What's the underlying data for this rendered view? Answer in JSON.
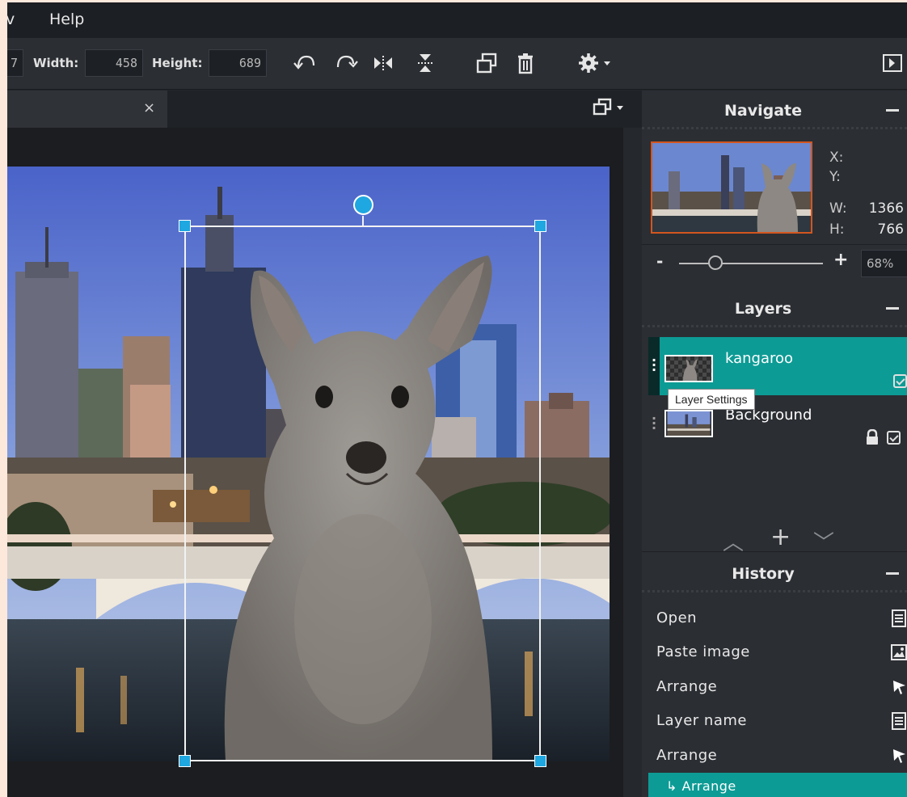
{
  "menu": {
    "partial_item": "v",
    "help": "Help"
  },
  "toolbar": {
    "x_partial_value": "7",
    "width_label": "Width:",
    "width_value": "458",
    "height_label": "Height:",
    "height_value": "689",
    "icons": [
      "undo-icon",
      "redo-icon",
      "flip-horizontal-icon",
      "flip-vertical-icon",
      "duplicate-icon",
      "delete-icon",
      "settings-icon",
      "toggle-panel-icon"
    ]
  },
  "document_tab": {
    "close_symbol": "×"
  },
  "navigate": {
    "title": "Navigate",
    "x_label": "X:",
    "y_label": "Y:",
    "w_label": "W:",
    "w_value": "1366",
    "h_label": "H:",
    "h_value": "766",
    "zoom_minus": "-",
    "zoom_plus": "+",
    "zoom_value": "68%",
    "zoom_fraction": 0.25
  },
  "layers": {
    "title": "Layers",
    "items": [
      {
        "name": "kangaroo",
        "active": true
      },
      {
        "name": "Background",
        "active": false,
        "locked": true
      }
    ],
    "tooltip": "Layer Settings",
    "controls": {
      "up": "︿",
      "add": "+",
      "down": "﹀"
    }
  },
  "history": {
    "title": "History",
    "items": [
      {
        "label": "Open",
        "icon": "document-icon"
      },
      {
        "label": "Paste image",
        "icon": "image-icon"
      },
      {
        "label": "Arrange",
        "icon": "pointer-icon"
      },
      {
        "label": "Layer name",
        "icon": "document-icon"
      },
      {
        "label": "Arrange",
        "icon": "pointer-icon"
      }
    ],
    "active_item": "↳ Arrange"
  },
  "colors": {
    "accent": "#0d9b95",
    "handle": "#1ea7e0",
    "nav_border": "#d3561f"
  }
}
